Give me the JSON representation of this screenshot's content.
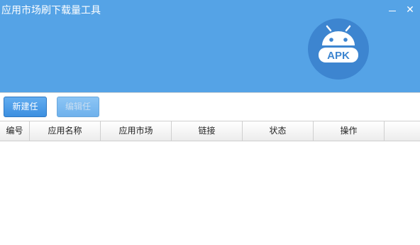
{
  "window": {
    "title": "应用市场刷下载量工具",
    "minimize_glyph": "",
    "close_glyph": "✕"
  },
  "logo": {
    "text": "APK",
    "icon": "android-apk-logo"
  },
  "toolbar": {
    "new_task": "新建任务",
    "edit_task": "编辑任务"
  },
  "table": {
    "columns": [
      "编号",
      "应用名称",
      "应用市场",
      "链接",
      "状态",
      "操作",
      ""
    ],
    "rows": []
  },
  "colors": {
    "header_bg": "#55a3e6",
    "button_blue": "#3c8fe0",
    "logo_bg": "#3d85d0"
  }
}
